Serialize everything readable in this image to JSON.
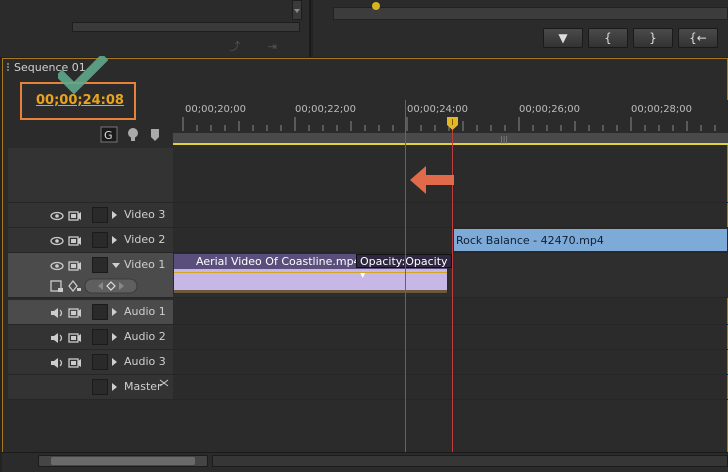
{
  "sequence": {
    "tab_label": "Sequence 01",
    "timecode": "00;00;24:08"
  },
  "ruler": {
    "ticks": [
      "00;00;20;00",
      "00;00;22;00",
      "00;00;24;00",
      "00;00;26;00",
      "00;00;28;00"
    ]
  },
  "transport_buttons": [
    "▼",
    "{",
    "}",
    "{←"
  ],
  "tracks": {
    "video": [
      {
        "label": "Video 3"
      },
      {
        "label": "Video 2"
      },
      {
        "label": "Video 1"
      }
    ],
    "audio": [
      {
        "label": "Audio 1"
      },
      {
        "label": "Audio 2"
      },
      {
        "label": "Audio 3"
      },
      {
        "label": "Master"
      }
    ]
  },
  "clips": {
    "video1_clip_name": "Aerial Video Of Coastline.mp4",
    "video1_opacity_label": "Opacity:Opacity",
    "video2_clip_name": "Rock Balance - 42470.mp4"
  },
  "colors": {
    "accent_orange": "#e8823a",
    "timecode": "#e8a41f",
    "playhead": "#c23c3c",
    "clip_purple": "#c6b7e6",
    "clip_blue": "#7eaad8",
    "checkmark": "#5fa88c"
  }
}
